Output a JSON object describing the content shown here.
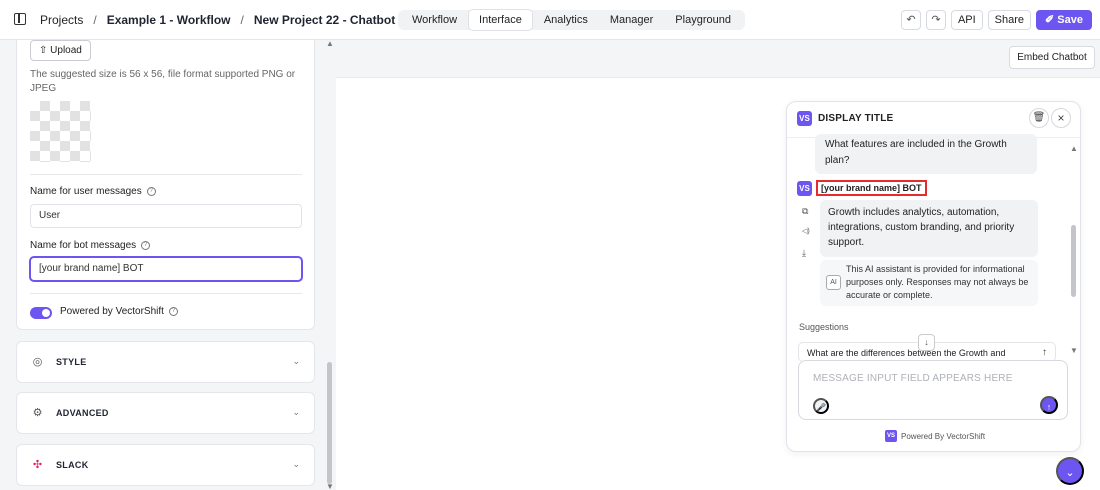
{
  "topbar": {
    "breadcrumb": {
      "projects": "Projects",
      "sep": "/",
      "workflow": "Example 1 - Workflow",
      "project": "New Project 22 - Chatbot"
    },
    "tabs": [
      "Workflow",
      "Interface",
      "Analytics",
      "Manager",
      "Playground"
    ],
    "active_tab": "Interface",
    "undo_icon": "↶",
    "redo_icon": "↷",
    "api_label": "API",
    "share_label": "Share",
    "save_label": "✐ Save"
  },
  "left_panel": {
    "upload_label": "⇧ Upload",
    "upload_hint": "The suggested size is 56 x 56, file format supported PNG or JPEG",
    "user_messages_label": "Name for user messages",
    "user_messages_value": "User",
    "bot_messages_label": "Name for bot messages",
    "bot_messages_value": "[your brand name] BOT",
    "powered_toggle_label": "Powered by VectorShift",
    "powered_toggle_on": true,
    "info_glyph": "?",
    "sections": [
      {
        "title": "STYLE",
        "icon": "palette-icon",
        "glyph": "◎"
      },
      {
        "title": "ADVANCED",
        "icon": "gear-icon",
        "glyph": "⚙"
      },
      {
        "title": "SLACK",
        "icon": "slack-icon",
        "glyph": "✣"
      }
    ],
    "chevron": "⌄"
  },
  "canvas": {
    "embed_label": "Embed Chatbot"
  },
  "chat": {
    "badge": "VS",
    "title": "DISPLAY TITLE",
    "user_message": "What features are included in the Growth plan?",
    "bot_name": "[your brand name] BOT",
    "bot_message": "Growth includes analytics, automation, integrations, custom branding, and priority support.",
    "ai_badge": "AI",
    "disclaimer": "This AI assistant is provided for informational purposes only. Responses may not always be accurate or complete.",
    "suggestions_label": "Suggestions",
    "suggestion_1": "What are the differences between the Growth and",
    "input_placeholder": "MESSAGE INPUT FIELD APPEARS HERE",
    "powered_by": "Powered By VectorShift",
    "icons": {
      "trash": "🗑",
      "close": "×",
      "copy": "⧉",
      "speaker": "◁)",
      "download": "⤓",
      "mic": "🎤",
      "send": "↑",
      "arrow_up": "↑",
      "arrow_down": "↓",
      "fab": "⌄"
    }
  },
  "colors": {
    "accent": "#6c55f0",
    "highlight": "#e52b2b"
  }
}
